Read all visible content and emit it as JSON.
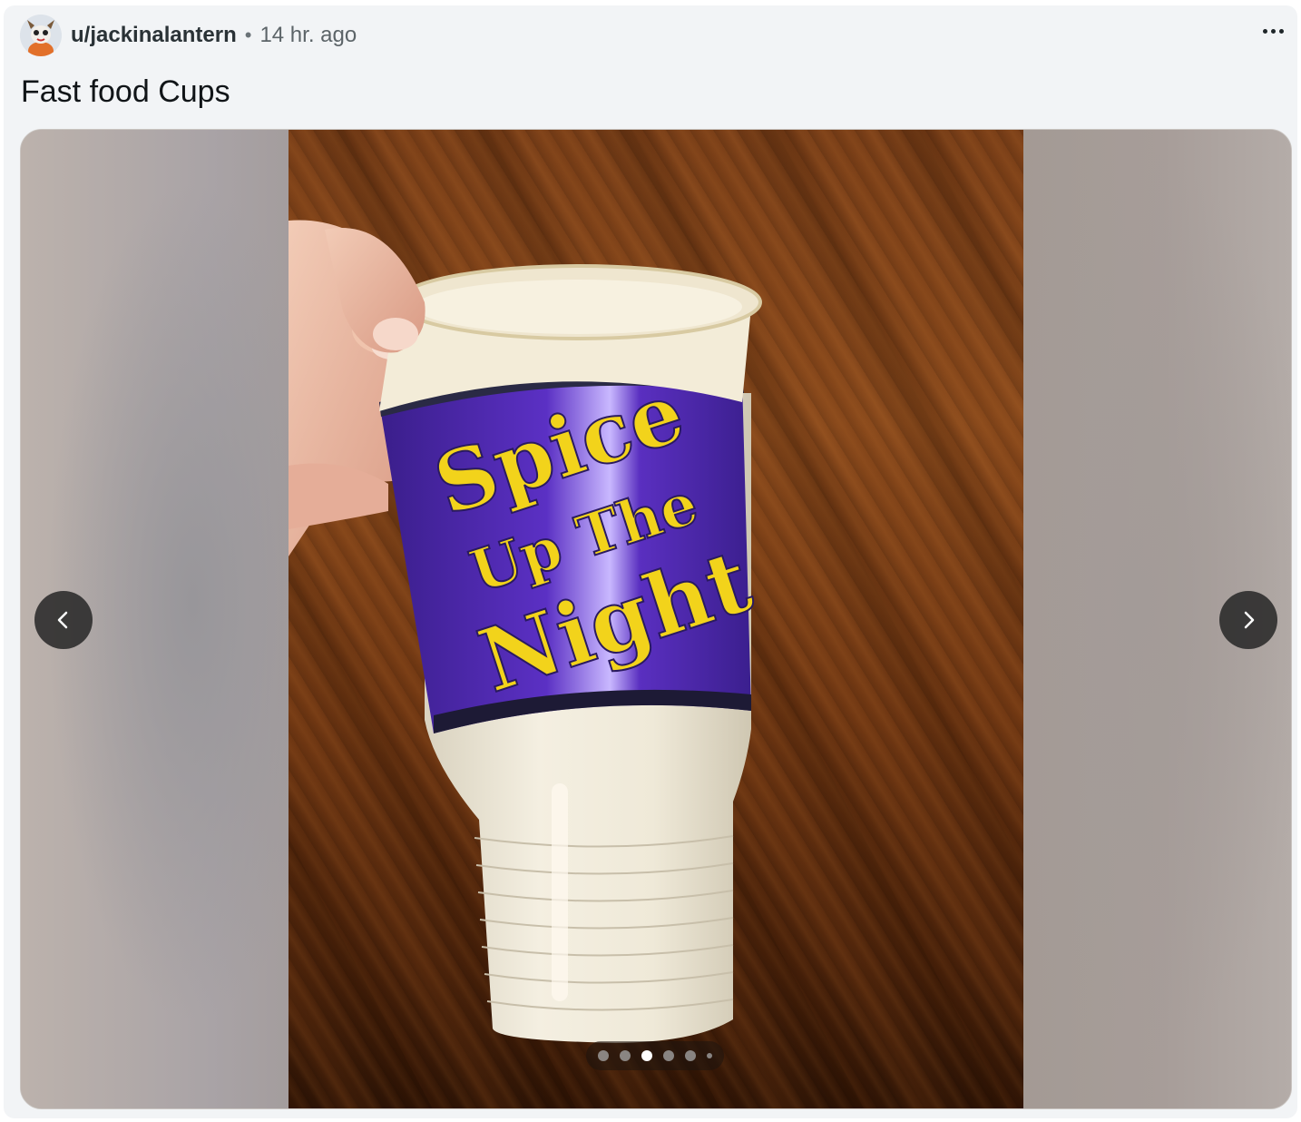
{
  "post": {
    "username": "u/jackinalantern",
    "separator": "•",
    "time_ago": "14 hr. ago",
    "title": "Fast food Cups"
  },
  "icons": {
    "avatar": "avatar-icon",
    "more": "more-options-icon",
    "prev": "chevron-left-icon",
    "next": "chevron-right-icon"
  },
  "gallery": {
    "photo_text": {
      "line1": "Spice",
      "line2": "Up The",
      "line3": "Night"
    },
    "total_images": 6,
    "current_index": 3
  },
  "colors": {
    "card_bg": "#f2f4f6",
    "cup_band": "#4a25a8",
    "cup_text": "#f2d31b",
    "nav_button": "#262626"
  }
}
